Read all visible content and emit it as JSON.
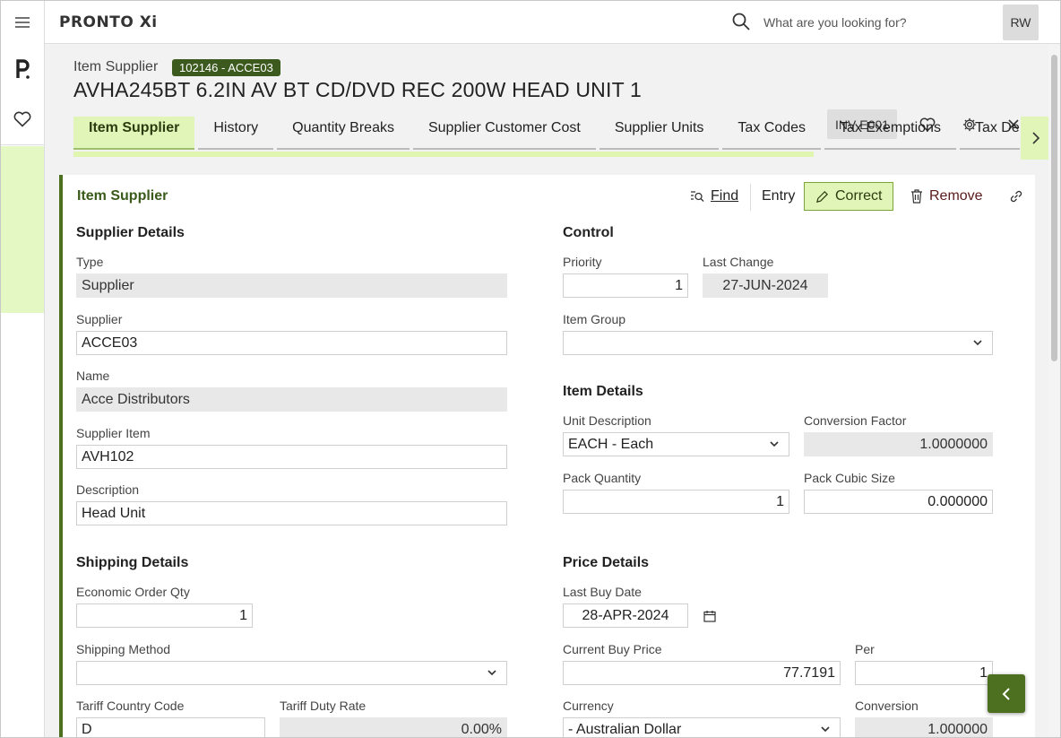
{
  "app": {
    "logo": "PRONTO Xi"
  },
  "topbar": {
    "search_placeholder": "What are you looking for?",
    "avatar": "RW"
  },
  "header": {
    "subtitle": "Item Supplier",
    "badge": "102146 - ACCE03",
    "title": "AVHA245BT 6.2IN AV BT CD/DVD REC 200W HEAD UNIT 1",
    "inv_button": "INV E001"
  },
  "tabs": [
    {
      "label": "Item Supplier",
      "active": true
    },
    {
      "label": "History"
    },
    {
      "label": "Quantity Breaks"
    },
    {
      "label": "Supplier Customer Cost"
    },
    {
      "label": "Supplier Units"
    },
    {
      "label": "Tax Codes"
    },
    {
      "label": "Tax Exemptions"
    },
    {
      "label": "Tax Defaults"
    }
  ],
  "panel": {
    "title": "Item Supplier",
    "toolbar": {
      "find": "Find",
      "entry": "Entry",
      "correct": "Correct",
      "remove": "Remove"
    }
  },
  "supplier_details": {
    "heading": "Supplier Details",
    "type_label": "Type",
    "type_value": "Supplier",
    "supplier_label": "Supplier",
    "supplier_value": "ACCE03",
    "name_label": "Name",
    "name_value": "Acce Distributors",
    "supplier_item_label": "Supplier Item",
    "supplier_item_value": "AVH102",
    "description_label": "Description",
    "description_value": "Head Unit"
  },
  "control": {
    "heading": "Control",
    "priority_label": "Priority",
    "priority_value": "1",
    "last_change_label": "Last Change",
    "last_change_value": "27-JUN-2024",
    "item_group_label": "Item Group",
    "item_group_value": ""
  },
  "item_details": {
    "heading": "Item Details",
    "unit_desc_label": "Unit Description",
    "unit_desc_value": "EACH - Each",
    "conv_factor_label": "Conversion Factor",
    "conv_factor_value": "1.0000000",
    "pack_qty_label": "Pack Quantity",
    "pack_qty_value": "1",
    "pack_cubic_label": "Pack Cubic Size",
    "pack_cubic_value": "0.000000"
  },
  "shipping": {
    "heading": "Shipping Details",
    "eoq_label": "Economic Order Qty",
    "eoq_value": "1",
    "method_label": "Shipping Method",
    "method_value": "",
    "tariff_country_label": "Tariff Country Code",
    "tariff_country_value": "D",
    "tariff_duty_label": "Tariff Duty Rate",
    "tariff_duty_value": "0.00%"
  },
  "price": {
    "heading": "Price Details",
    "last_buy_label": "Last Buy Date",
    "last_buy_value": "28-APR-2024",
    "current_buy_label": "Current Buy Price",
    "current_buy_value": "77.7191",
    "per_label": "Per",
    "per_value": "1",
    "currency_label": "Currency",
    "currency_value": "- Australian Dollar",
    "conversion_label": "Conversion",
    "conversion_value": "1.000000"
  },
  "colors": {
    "accent": "#4c7020",
    "tab_active": "#e2f5b8",
    "badge": "#3c5a1e"
  }
}
